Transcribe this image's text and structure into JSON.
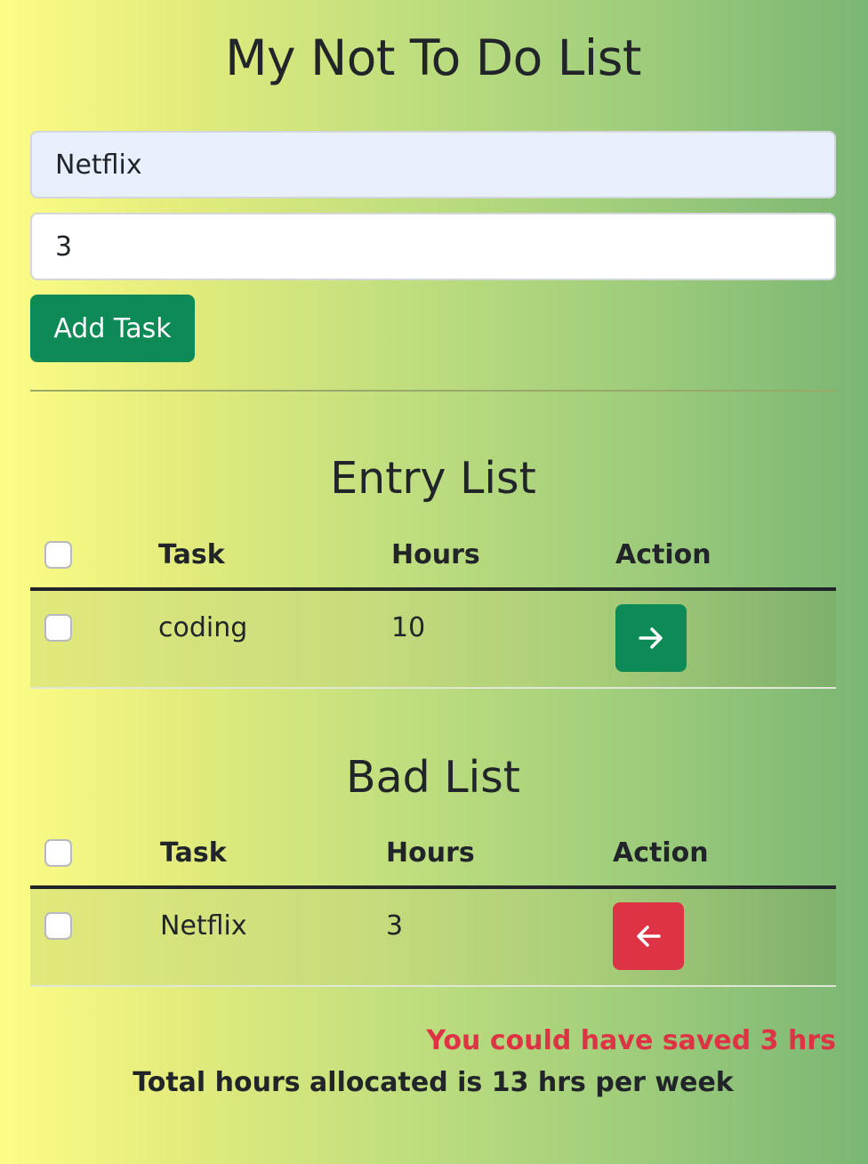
{
  "page_title": "My Not To Do List",
  "form": {
    "task_value": "Netflix",
    "hours_value": "3",
    "add_button_label": "Add Task"
  },
  "entry_list": {
    "title": "Entry List",
    "headers": {
      "task": "Task",
      "hours": "Hours",
      "action": "Action"
    },
    "rows": [
      {
        "task": "coding",
        "hours": "10",
        "action_icon": "arrow-right-icon",
        "action_color": "#0d8a56"
      }
    ]
  },
  "bad_list": {
    "title": "Bad List",
    "headers": {
      "task": "Task",
      "hours": "Hours",
      "action": "Action"
    },
    "rows": [
      {
        "task": "Netflix",
        "hours": "3",
        "action_icon": "arrow-left-icon",
        "action_color": "#de3345"
      }
    ]
  },
  "summary": {
    "saved_text": "You could have saved 3 hrs",
    "total_text": "Total hours allocated is 13 hrs per week"
  },
  "colors": {
    "primary_green": "#0d8a56",
    "danger_red": "#de3345"
  }
}
